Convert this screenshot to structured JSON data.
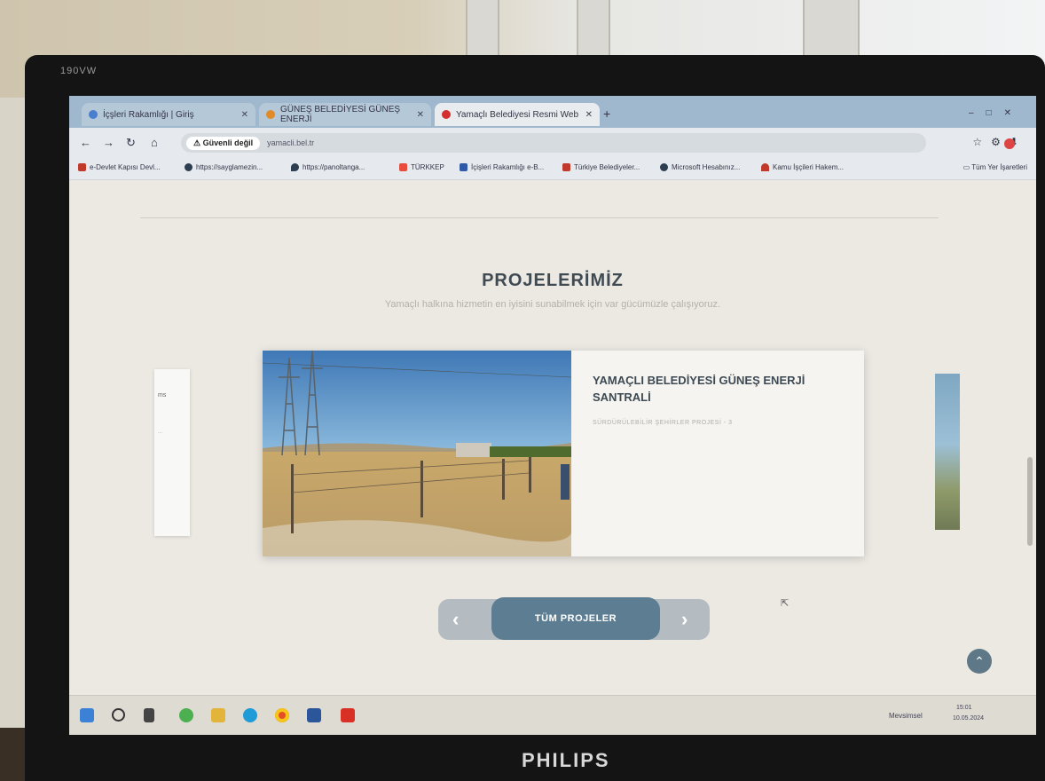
{
  "monitor": {
    "model": "190VW",
    "brand": "PHILIPS"
  },
  "browser": {
    "tabs": [
      {
        "label": "İçşleri Rakamlığı | Giriş",
        "favicon_color": "#4a7fd0"
      },
      {
        "label": "GÜNEŞ BELEDİYESİ GÜNEŞ ENERJİ",
        "favicon_color": "#e08a2a"
      },
      {
        "label": "Yamaçlı Belediyesi Resmi Web",
        "favicon_color": "#d32f2f"
      }
    ],
    "security_label": "Güvenli değil",
    "url": "yamacli.bel.tr",
    "bookmarks": [
      {
        "label": "e-Devlet Kapısı Devl...",
        "color": "#c0392b"
      },
      {
        "label": "https://sayglamezin...",
        "color": "#2c3e50"
      },
      {
        "label": "https://panoltanga...",
        "color": "#2c3e50"
      },
      {
        "label": "TÜRKKEP",
        "color": "#e74c3c"
      },
      {
        "label": "İçişleri Rakamlığı e-B...",
        "color": "#2e5aa8"
      },
      {
        "label": "Türkiye Belediyeler...",
        "color": "#c0392b"
      },
      {
        "label": "Microsoft Hesabınız...",
        "color": "#2c3e50"
      },
      {
        "label": "Kamu İşçileri Hakem...",
        "color": "#c0392b"
      }
    ],
    "bookmarks_folder": "Tüm Yer İşaretleri"
  },
  "page": {
    "section_title": "PROJELERİMİZ",
    "section_subtitle": "Yamaçlı halkına hizmetin en iyisini sunabilmek için var gücümüzle çalışıyoruz.",
    "featured_project": {
      "title": "YAMAÇLI BELEDİYESİ GÜNEŞ ENERJİ SANTRALİ",
      "category": "SÜRDÜRÜLEBİLİR ŞEHİRLER PROJESİ - 3"
    },
    "side_card_left": {
      "text1": "ms",
      "text2": "..."
    },
    "all_projects_label": "TÜM PROJELER",
    "prev_arrow": "‹",
    "next_arrow": "›",
    "scroll_top_icon": "⌃"
  },
  "taskbar": {
    "tray_weather": "Mevsimsel",
    "time": "15:01",
    "date": "10.05.2024"
  }
}
